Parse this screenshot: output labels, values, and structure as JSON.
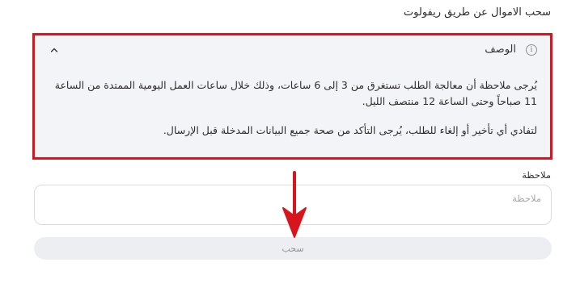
{
  "page": {
    "title": "سحب الاموال عن طريق ريفولوت"
  },
  "description": {
    "label": "الوصف",
    "info_icon": "info-icon",
    "info_glyph": "i",
    "toggle_icon": "chevron-up-icon",
    "paragraph_1": "يُرجى ملاحظة أن معالجة الطلب تستغرق من 3 إلى 6 ساعات، وذلك خلال ساعات العمل اليومية الممتدة من الساعة 11 صباحاً وحتى الساعة 12 منتصف الليل.",
    "paragraph_2": "لتفادي أي تأخير أو إلغاء للطلب، يُرجى التأكد من صحة جميع البيانات المدخلة قبل الإرسال."
  },
  "note": {
    "label": "ملاحظة",
    "placeholder": "ملاحظة",
    "value": ""
  },
  "submit": {
    "label": "سحب"
  },
  "colors": {
    "highlight_border": "#d8141c",
    "arrow": "#d8141c",
    "box_bg": "#f3f4f7",
    "button_bg": "#eceef1"
  }
}
